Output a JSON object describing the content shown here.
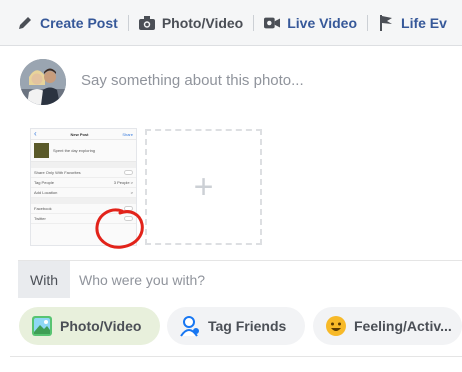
{
  "tabs": {
    "create_post": "Create Post",
    "photo_video": "Photo/Video",
    "live_video": "Live Video",
    "life_event": "Life Ev"
  },
  "composer": {
    "placeholder": "Say something about this photo..."
  },
  "thumbnail": {
    "title": "New Post",
    "share": "Share",
    "caption": "Spent the day exploring",
    "rows": [
      {
        "label": "Share Only With Favorites",
        "value": ""
      },
      {
        "label": "Tag People",
        "value": "3 People >"
      },
      {
        "label": "Add Location",
        "value": ">"
      },
      {
        "label": "Facebook",
        "value": ""
      },
      {
        "label": "Twitter",
        "value": ""
      }
    ]
  },
  "with_row": {
    "label": "With",
    "placeholder": "Who were you with?"
  },
  "actions": {
    "photo_video": "Photo/Video",
    "tag_friends": "Tag Friends",
    "feeling": "Feeling/Activ..."
  },
  "colors": {
    "link": "#365899",
    "photo_pill_bg": "#e8f0dc",
    "annotation_red": "#e2231a"
  }
}
